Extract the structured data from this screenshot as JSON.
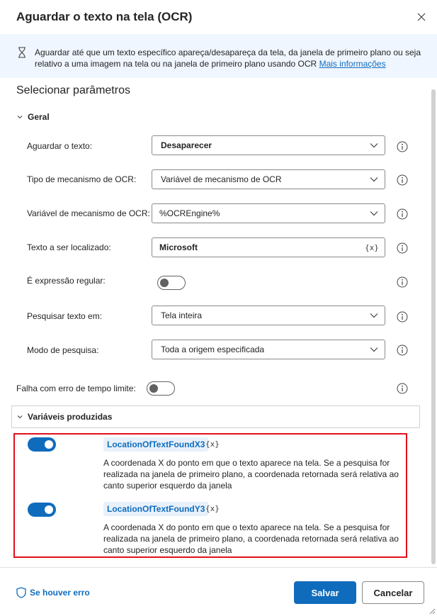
{
  "dialog": {
    "title": "Aguardar o texto na tela (OCR)"
  },
  "banner": {
    "text": "Aguardar até que um texto específico apareça/desapareça da tela, da janela de primeiro plano ou seja relativo a uma imagem na tela ou na janela de primeiro plano usando OCR",
    "link": "Mais informações"
  },
  "section_title": "Selecionar parâmetros",
  "general": {
    "header": "Geral",
    "wait_text": {
      "label": "Aguardar o texto:",
      "value": "Desaparecer"
    },
    "ocr_engine_type": {
      "label": "Tipo de mecanismo de OCR:",
      "value": "Variável de mecanismo de OCR"
    },
    "ocr_engine_var": {
      "label": "Variável de mecanismo de OCR:",
      "value": "%OCREngine%"
    },
    "text_to_find": {
      "label": "Texto a ser localizado:",
      "value": "Microsoft",
      "var_icon": "{x}"
    },
    "is_regex": {
      "label": "É expressão regular:",
      "on": false
    },
    "search_in": {
      "label": "Pesquisar texto em:",
      "value": "Tela inteira"
    },
    "search_mode": {
      "label": "Modo de pesquisa:",
      "value": "Toda a origem especificada"
    }
  },
  "timeout": {
    "label": "Falha com erro de tempo limite:",
    "on": false
  },
  "produced_vars": {
    "header": "Variáveis produzidas",
    "items": [
      {
        "name": "LocationOfTextFoundX3",
        "var_icon": "{x}",
        "on": true,
        "description": "A coordenada X do ponto em que o texto aparece na tela. Se a pesquisa for realizada na janela de primeiro plano, a coordenada retornada será relativa ao canto superior esquerdo da janela"
      },
      {
        "name": "LocationOfTextFoundY3",
        "var_icon": "{x}",
        "on": true,
        "description": "A coordenada X do ponto em que o texto aparece na tela. Se a pesquisa for realizada na janela de primeiro plano, a coordenada retornada será relativa ao canto superior esquerdo da janela"
      }
    ]
  },
  "footer": {
    "on_error": "Se houver erro",
    "save": "Salvar",
    "cancel": "Cancelar"
  },
  "colors": {
    "accent": "#0f6cbd",
    "banner_bg": "#f0f6ff",
    "highlight": "#e2101d"
  },
  "icons": {
    "close": "close-icon",
    "hourglass": "hourglass-icon",
    "chevron": "chevron-down-icon",
    "info": "info-icon",
    "shield": "shield-icon"
  }
}
